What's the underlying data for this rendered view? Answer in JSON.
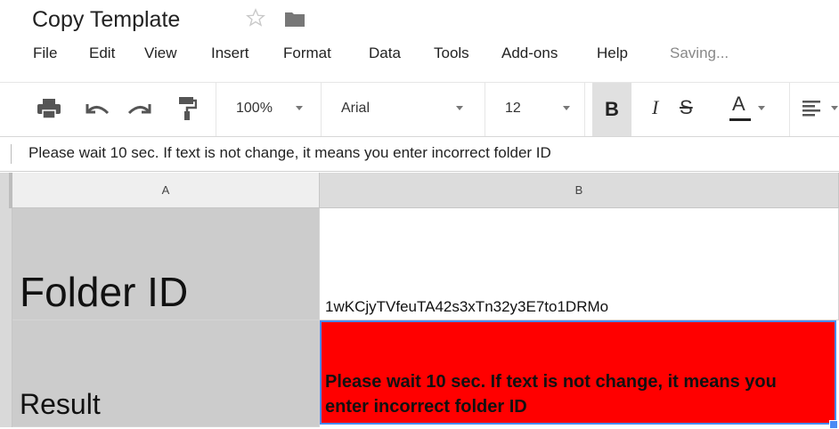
{
  "document": {
    "title": "Copy Template"
  },
  "menu": {
    "items": [
      "File",
      "Edit",
      "View",
      "Insert",
      "Format",
      "Data",
      "Tools",
      "Add-ons",
      "Help"
    ],
    "status": "Saving..."
  },
  "toolbar": {
    "zoom": "100%",
    "font": "Arial",
    "font_size": "12",
    "bold_label": "B",
    "italic_label": "I",
    "strike_label": "S",
    "text_color_label": "A"
  },
  "formula_bar": {
    "value": "Please wait 10 sec. If text is not change, it means you enter incorrect folder ID"
  },
  "sheet": {
    "columns": [
      "A",
      "B"
    ],
    "cells": {
      "A1": "Folder ID",
      "B1": "1wKCjyTVfeuTA42s3xTn32y3E7to1DRMo",
      "A2": "Result",
      "B2": "Please wait 10 sec. If text is not change, it means you enter incorrect folder ID"
    },
    "colors": {
      "result_fill": "#ff0000",
      "label_fill": "#cccccc",
      "selection": "#4a8af4"
    }
  }
}
